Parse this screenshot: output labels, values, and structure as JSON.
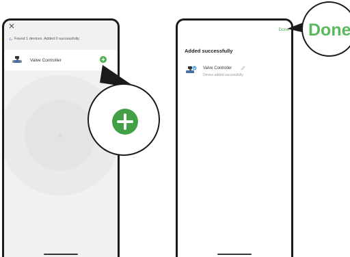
{
  "left_screen": {
    "status_text": "Found 1 devices. Added 0 successfully.",
    "device_name": "Valve Controller"
  },
  "right_screen": {
    "done_label": "Done",
    "title": "Added successfully",
    "device_name": "Valve Controller",
    "device_status": "Device added successfully"
  },
  "callouts": {
    "done_zoom_label": "Done"
  },
  "colors": {
    "accent_green": "#4caf50",
    "phone_frame": "#1a1a1a"
  },
  "icons": [
    "close-icon",
    "refresh-icon",
    "valve-icon",
    "add-icon",
    "check-badge-icon",
    "edit-icon"
  ]
}
